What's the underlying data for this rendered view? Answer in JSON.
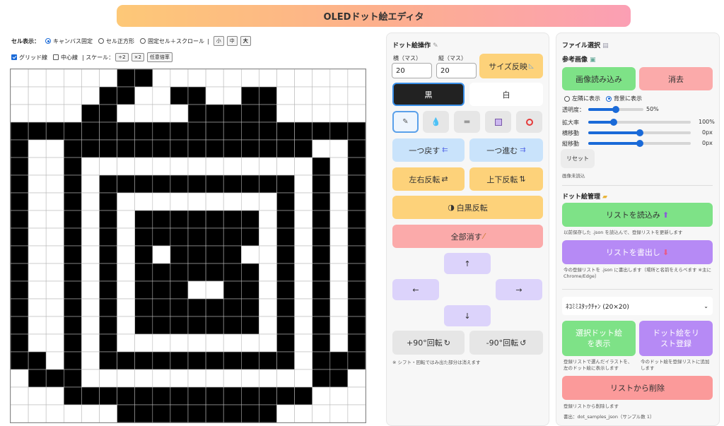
{
  "title": "OLEDドット絵エディタ",
  "toolbar": {
    "cell_label": "セル表示：",
    "opt_canvas": "キャンバス固定",
    "opt_square": "セル正方形",
    "opt_scroll": "固定セル＋スクロール",
    "sep": "|",
    "size_s": "小",
    "size_m": "中",
    "size_l": "大",
    "grid_line": "グリッド線",
    "center_line": "中心線",
    "scale_label": "| スケール：",
    "half": "÷2",
    "double": "×2",
    "custom": "任意倍率"
  },
  "grid": {
    "cols": 20,
    "rows": 20,
    "rows_data": [
      "00000011000000000000",
      "00000110011001100000",
      "00001100001111100000",
      "11111111111111111111",
      "10011111111111111001",
      "10010000000000000101",
      "10010111111111110101",
      "10010100000000010101",
      "10010101111111010101",
      "10010101111111010101",
      "10010101011110010101",
      "10010101111111010101",
      "10010101110011010101",
      "10010101111111010101",
      "10010101111111010101",
      "10010100000000010101",
      "11010111111111110111",
      "01110000000000000110",
      "00011111111111111000",
      "00000011111111100000"
    ]
  },
  "dot_ops": {
    "title": "ドット絵操作",
    "title_icon": "pencil-icon",
    "w_label": "横（マス）",
    "h_label": "縦（マス）",
    "w_value": "20",
    "h_value": "20",
    "apply_size": "サイズ反映",
    "black": "黒",
    "white": "白",
    "tools": [
      "pen-icon",
      "bucket-icon",
      "eraser-icon",
      "square-icon",
      "circle-icon"
    ],
    "undo": "一つ戻す",
    "redo": "一つ進む",
    "flip_h": "左右反転",
    "flip_v": "上下反転",
    "invert": "白黒反転",
    "clear": "全部消す",
    "up": "↑",
    "down": "↓",
    "left": "←",
    "right": "→",
    "rot_cw": "+90°回転",
    "rot_ccw": "-90°回転",
    "note": "※ シフト・回転ではみ出た部分は消えます"
  },
  "file": {
    "title": "ファイル選択",
    "ref_title": "参考画像",
    "load_image": "画像読み込み",
    "erase": "消去",
    "show_side": "左隣に表示",
    "show_bg": "背景に表示",
    "opacity_label": "透明度：",
    "opacity_value": "50%",
    "opacity": 0.5,
    "zoom_label": "拡大率",
    "zoom_value": "100%",
    "zoom": 0.25,
    "hmove_label": "横移動",
    "hmove_value": "0px",
    "hmove": 0.5,
    "vmove_label": "縦移動",
    "vmove_value": "0px",
    "vmove": 0.5,
    "reset": "リセット",
    "status": "画像未読込",
    "manage_title": "ドット絵管理",
    "load_list": "リストを読込み",
    "load_note": "以前保存した .json を読込んで、登録リストを更新します",
    "save_list": "リストを書出し",
    "save_note": "今の登録リストを .json に書出します（場所と名前をえらべます ※主に Chrome/Edge）",
    "select_value": "ﾈｺﾐﾐｽﾀｯｸﾁｬﾝ (20×20)",
    "show_selected": "選択ドット絵を表示",
    "show_selected_note": "登録リストで選んだイラストを、左のドット絵に表示します",
    "register": "ドット絵をリスト登録",
    "register_note": "今のドット絵を登録リストに追加します",
    "delete": "リストから削除",
    "delete_note": "登録リストから削除します",
    "footer": "書出：dot_samples_json（サンプル数 1）"
  },
  "colors": {
    "green": "#7ee287",
    "pink": "#fbaaaa",
    "purple": "#b68af5",
    "blue": "#c9e3fb",
    "orange": "#fdd27a",
    "lavender": "#dcd3fb",
    "gray": "#e9e9e9"
  }
}
